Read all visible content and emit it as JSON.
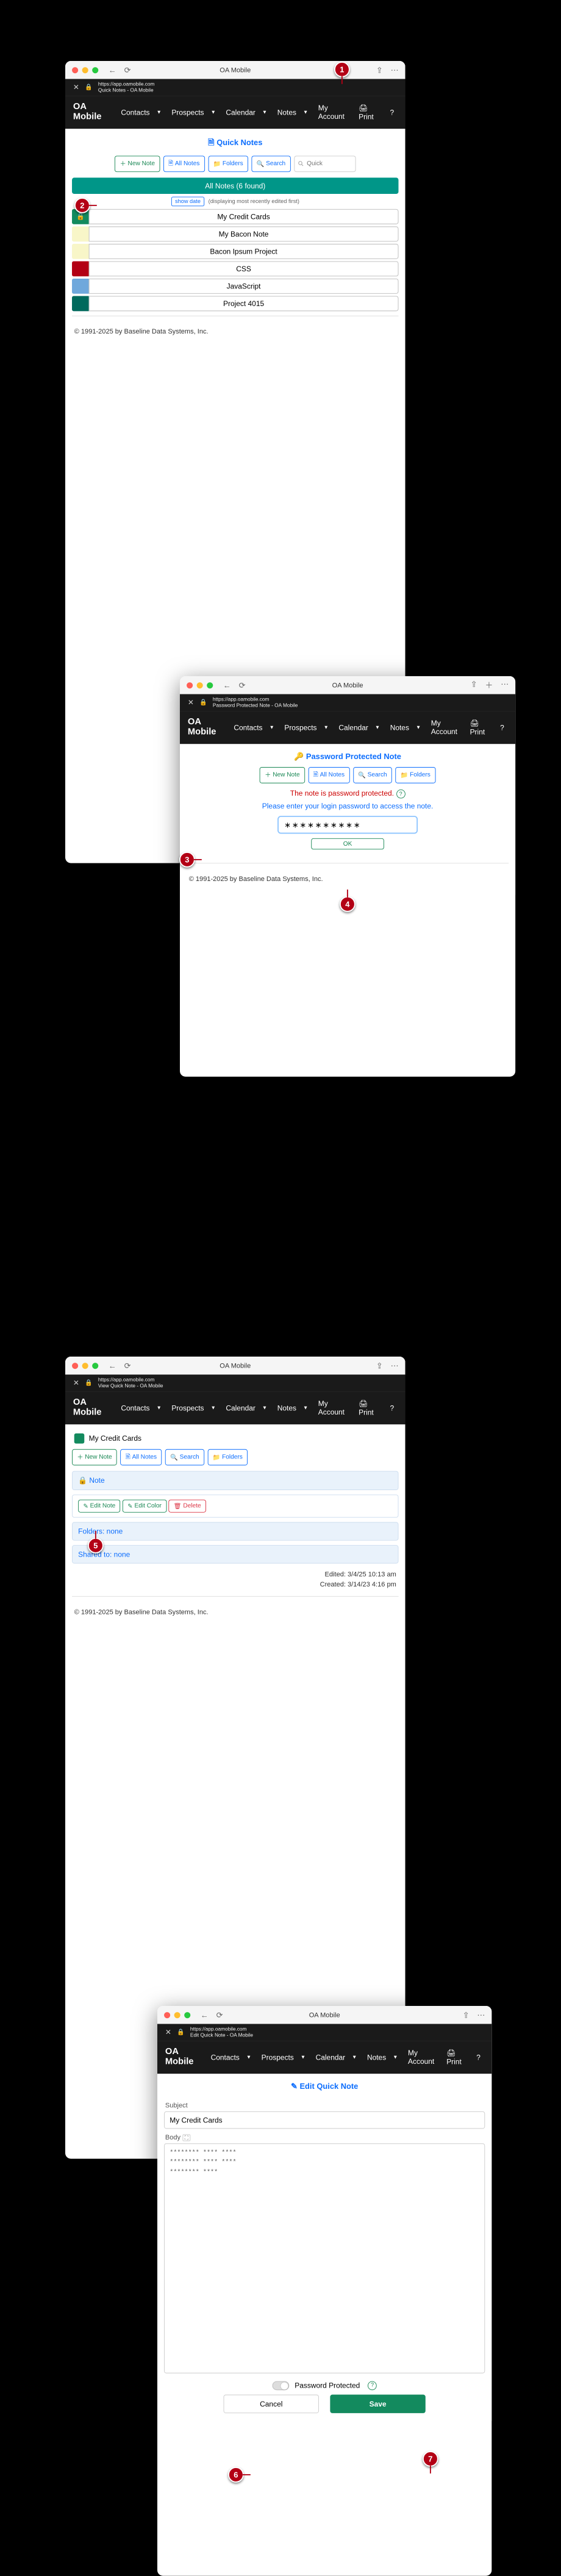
{
  "tb_title": "OA Mobile",
  "addr_url": "https://app.oamobile.com",
  "brand": "OA Mobile",
  "nav": {
    "contacts": "Contacts",
    "prospects": "Prospects",
    "calendar": "Calendar",
    "notes": "Notes",
    "account": "My Account",
    "print": "Print",
    "help": "?"
  },
  "footer": "© 1991-2025 by Baseline Data Systems, Inc.",
  "callouts": {
    "c1": "1",
    "c2": "2",
    "c3": "3",
    "c4": "4",
    "c5": "5",
    "c6": "6",
    "c7": "7"
  },
  "w1": {
    "addr_sub": "Quick Notes - OA Mobile",
    "heading": "Quick Notes",
    "btn_new": "New Note",
    "btn_all": "All Notes",
    "btn_folders": "Folders",
    "btn_search": "Search",
    "search_ph": "Quick",
    "banner": "All Notes (6 found)",
    "showdate_btn": "show date",
    "showdate_txt": "(displaying most recently edited first)",
    "notes": [
      {
        "color": "#138a5e",
        "label": "My Credit Cards",
        "locked": true
      },
      {
        "color": "#f8f6c8",
        "label": "My Bacon Note"
      },
      {
        "color": "#f8f6c8",
        "label": "Bacon Ipsum Project"
      },
      {
        "color": "#b30015",
        "label": "CSS"
      },
      {
        "color": "#6fa8dc",
        "label": "JavaScript"
      },
      {
        "color": "#00695c",
        "label": "Project 4015"
      }
    ]
  },
  "w2": {
    "addr_sub": "Password Protected Note - OA Mobile",
    "heading": "Password Protected Note",
    "btn_new": "New Note",
    "btn_all": "All Notes",
    "btn_search": "Search",
    "btn_folders": "Folders",
    "msg_red": "The note is password protected.",
    "msg_blue": "Please enter your login password to access the note.",
    "pw_value": "∗∗∗∗∗∗∗∗∗∗",
    "ok": "OK"
  },
  "w3": {
    "addr_sub": "View Quick Note - OA Mobile",
    "title": "My Credit Cards",
    "chip_color": "#138a5e",
    "btn_new": "New Note",
    "btn_all": "All Notes",
    "btn_search": "Search",
    "btn_folders": "Folders",
    "panel_note": "Note",
    "btn_edit": "Edit Note",
    "btn_color": "Edit Color",
    "btn_delete": "Delete",
    "panel_folders": "Folders: none",
    "panel_shared": "Shared to: none",
    "edited": "Edited: 3/4/25 10:13 am",
    "created": "Created: 3/14/23 4:16 pm"
  },
  "w4": {
    "addr_sub": "Edit Quick Note - OA Mobile",
    "heading": "Edit Quick Note",
    "subject_label": "Subject",
    "subject_value": "My Credit Cards",
    "body_label": "Body",
    "body_value": "******** **** ****\n******** **** ****\n******** ****",
    "pw_protected": "Password Protected",
    "cancel": "Cancel",
    "save": "Save"
  }
}
